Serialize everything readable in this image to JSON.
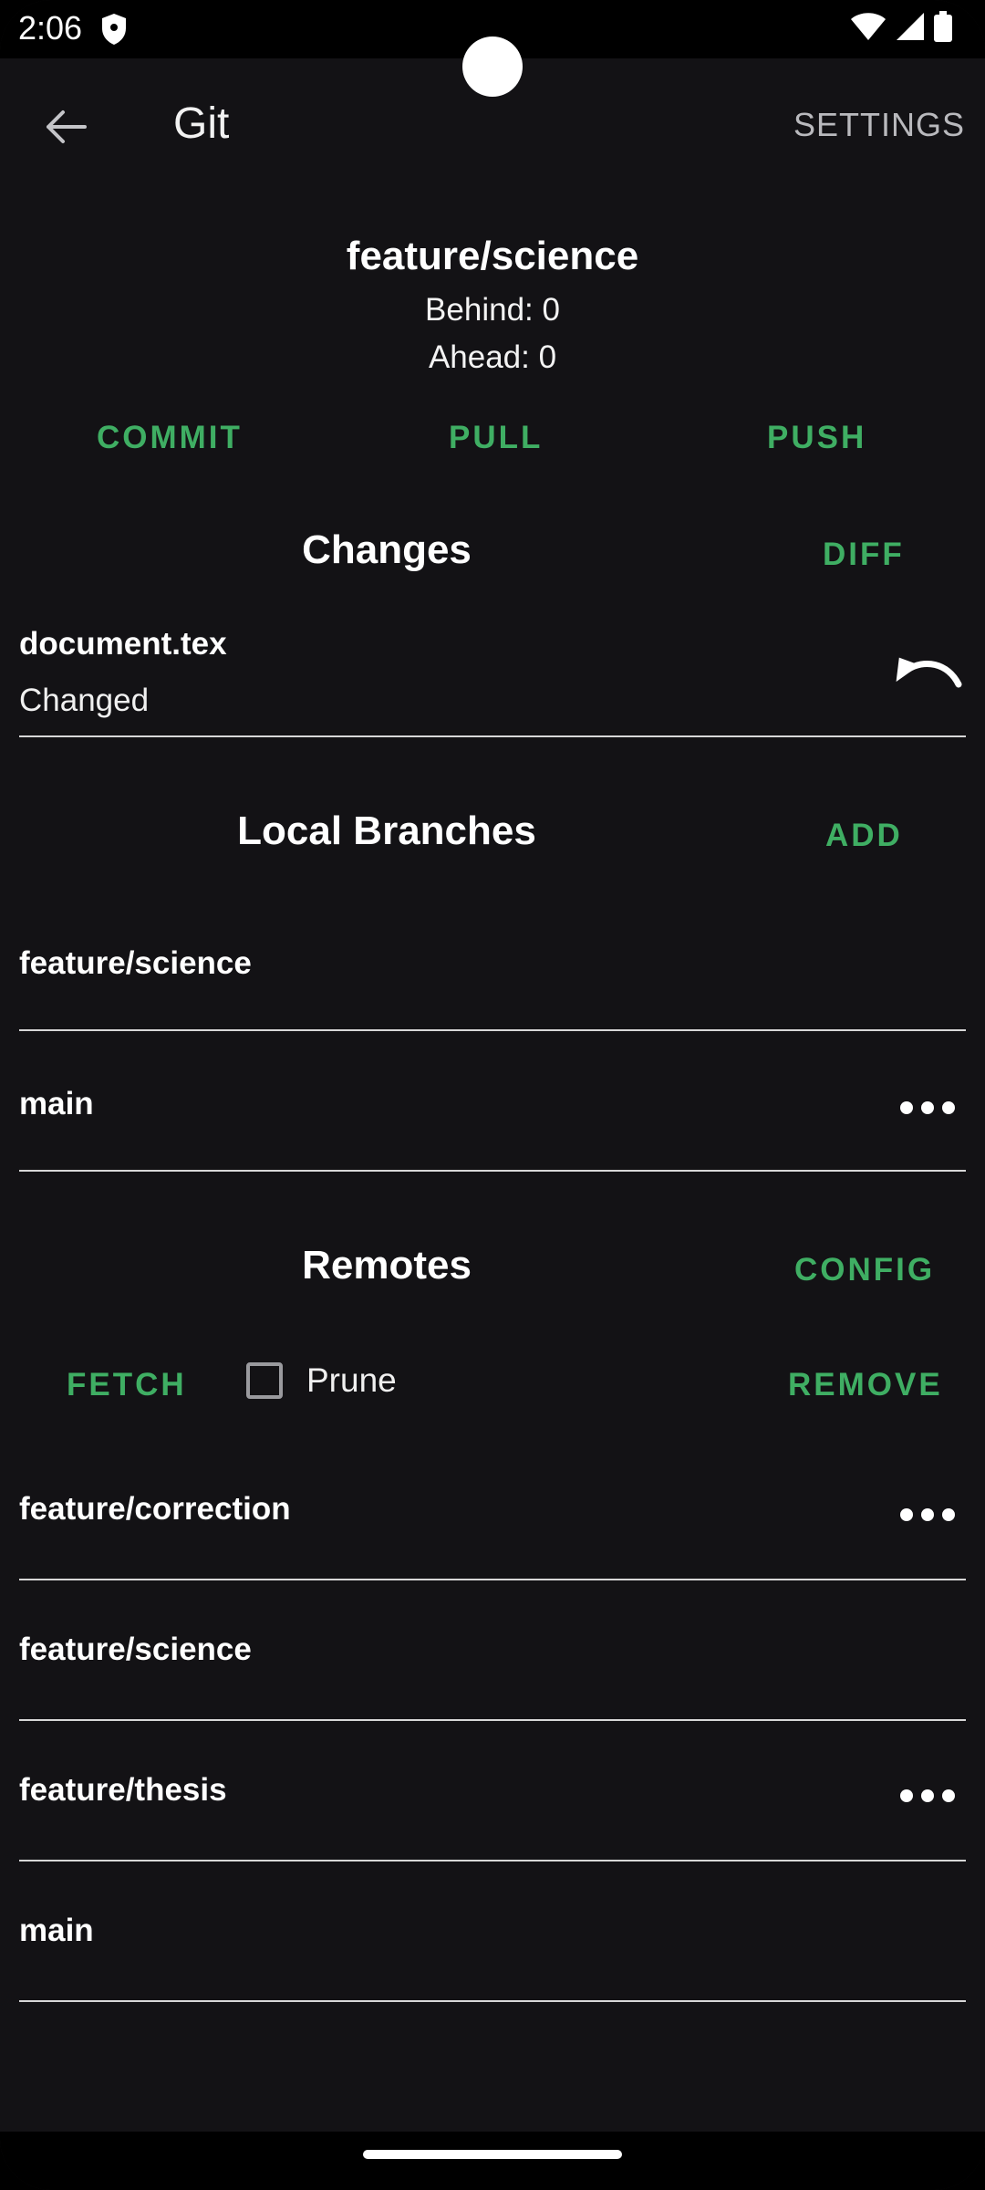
{
  "status": {
    "time": "2:06"
  },
  "app_bar": {
    "title": "Git",
    "settings_label": "SETTINGS"
  },
  "branch": {
    "name": "feature/science",
    "behind": "Behind: 0",
    "ahead": "Ahead: 0"
  },
  "actions": {
    "commit": "COMMIT",
    "pull": "PULL",
    "push": "PUSH"
  },
  "changes": {
    "title": "Changes",
    "action": "DIFF",
    "items": [
      {
        "file": "document.tex",
        "status": "Changed"
      }
    ]
  },
  "local_branches": {
    "title": "Local Branches",
    "action": "ADD",
    "items": [
      {
        "name": "feature/science"
      },
      {
        "name": "main"
      }
    ]
  },
  "remotes": {
    "title": "Remotes",
    "action": "CONFIG",
    "fetch_label": "FETCH",
    "prune_label": "Prune",
    "prune_checked": false,
    "remove_label": "REMOVE",
    "items": [
      {
        "name": "feature/correction"
      },
      {
        "name": "feature/science"
      },
      {
        "name": "feature/thesis"
      },
      {
        "name": "main"
      }
    ]
  },
  "colors": {
    "accent": "#3fae63",
    "background": "#131215",
    "divider": "#d7d7d7"
  }
}
